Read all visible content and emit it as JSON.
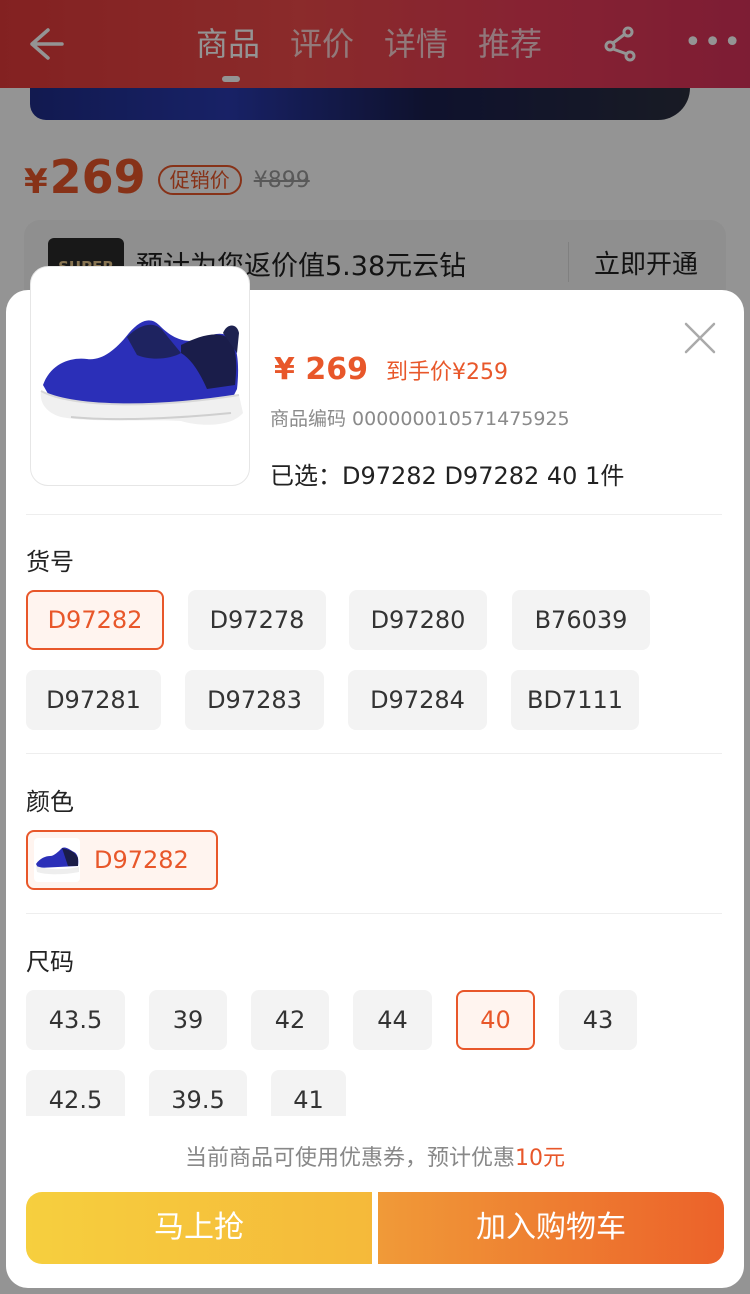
{
  "nav": {
    "tabs": [
      "商品",
      "评价",
      "详情",
      "推荐"
    ],
    "active_tab": 0,
    "back_icon": "back-arrow-icon",
    "share_icon": "share-icon",
    "more_icon": "more-icon"
  },
  "product_page": {
    "price_symbol": "¥",
    "price": "269",
    "promo_tag": "促销价",
    "original_price": "¥899",
    "super_logo": "SUPER",
    "super_text": "预计为您返价值5.38元云钻",
    "super_action": "立即开通"
  },
  "sheet": {
    "price": "¥ 269",
    "after_price": "到手价¥259",
    "product_code": "商品编码 000000010571475925",
    "selected": "已选：D97282 D97282 40  1件",
    "close_icon": "close-icon"
  },
  "sections": {
    "item_number_title": "货号",
    "item_numbers": [
      "D97282",
      "D97278",
      "D97280",
      "B76039",
      "D97281",
      "D97283",
      "D97284",
      "BD7111"
    ],
    "item_number_selected": "D97282",
    "color_title": "颜色",
    "colors": [
      "D97282"
    ],
    "color_selected": "D97282",
    "size_title": "尺码",
    "sizes": [
      "43.5",
      "39",
      "42",
      "44",
      "40",
      "43",
      "42.5",
      "39.5",
      "41"
    ],
    "size_selected": "40"
  },
  "coupon": {
    "text": "当前商品可使用优惠券，预计优惠",
    "amount": "10元"
  },
  "buttons": {
    "buy_now": "马上抢",
    "add_to_cart": "加入购物车"
  },
  "colors": {
    "accent": "#e8572a",
    "buy_button": "#f6cf3e",
    "cart_button": "#ec622a",
    "banner": "#e23a3a"
  }
}
